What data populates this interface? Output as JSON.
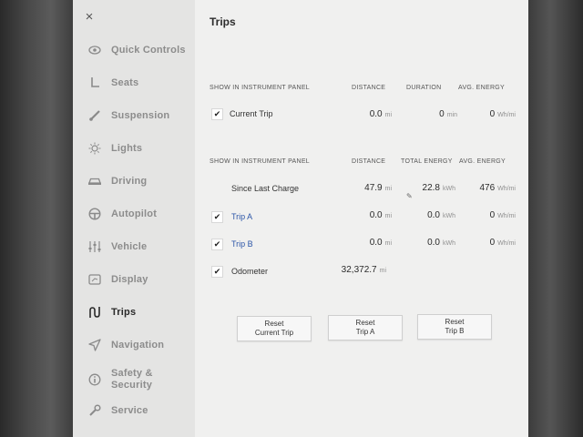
{
  "page_title": "Trips",
  "sidebar": {
    "close_glyph": "×",
    "items": [
      {
        "label": "Quick Controls",
        "icon": "eye-icon"
      },
      {
        "label": "Seats",
        "icon": "seat-icon"
      },
      {
        "label": "Suspension",
        "icon": "suspension-icon"
      },
      {
        "label": "Lights",
        "icon": "bulb-icon"
      },
      {
        "label": "Driving",
        "icon": "car-icon"
      },
      {
        "label": "Autopilot",
        "icon": "steering-wheel-icon"
      },
      {
        "label": "Vehicle",
        "icon": "sliders-icon"
      },
      {
        "label": "Display",
        "icon": "display-icon"
      },
      {
        "label": "Trips",
        "icon": "trips-icon",
        "active": true
      },
      {
        "label": "Navigation",
        "icon": "navigation-arrow-icon"
      },
      {
        "label": "Safety &",
        "label2": "Security",
        "icon": "info-icon"
      },
      {
        "label": "Service",
        "icon": "wrench-icon"
      }
    ]
  },
  "section1": {
    "header": {
      "show": "SHOW IN INSTRUMENT PANEL",
      "distance": "DISTANCE",
      "duration": "DURATION",
      "avg_energy": "AVG. ENERGY"
    },
    "row": {
      "label": "Current Trip",
      "checked": "✔",
      "distance": "0.0",
      "distance_unit": "mi",
      "duration": "0",
      "duration_unit": "min",
      "avg_energy": "0",
      "avg_energy_unit": "Wh/mi"
    }
  },
  "section2": {
    "header": {
      "show": "SHOW IN INSTRUMENT PANEL",
      "distance": "DISTANCE",
      "total_energy": "TOTAL ENERGY",
      "avg_energy": "AVG. ENERGY"
    },
    "since_charge": {
      "label": "Since Last Charge",
      "distance": "47.9",
      "distance_unit": "mi",
      "total_energy": "22.8",
      "total_energy_unit": "kWh",
      "avg_energy": "476",
      "avg_energy_unit": "Wh/mi"
    },
    "trip_a": {
      "label": "Trip A",
      "checked": "✔",
      "distance": "0.0",
      "distance_unit": "mi",
      "total_energy": "0.0",
      "total_energy_unit": "kWh",
      "avg_energy": "0",
      "avg_energy_unit": "Wh/mi"
    },
    "trip_b": {
      "label": "Trip B",
      "checked": "✔",
      "distance": "0.0",
      "distance_unit": "mi",
      "total_energy": "0.0",
      "total_energy_unit": "kWh",
      "avg_energy": "0",
      "avg_energy_unit": "Wh/mi"
    },
    "odometer": {
      "label": "Odometer",
      "checked": "✔",
      "value": "32,372.7",
      "unit": "mi"
    }
  },
  "buttons": {
    "reset_current_1": "Reset",
    "reset_current_2": "Current Trip",
    "reset_a_1": "Reset",
    "reset_a_2": "Trip A",
    "reset_b_1": "Reset",
    "reset_b_2": "Trip B"
  },
  "colors": {
    "link_blue": "#2d56a8",
    "sidebar_bg": "#e4e4e3",
    "panel_bg": "#f0f0ef"
  }
}
